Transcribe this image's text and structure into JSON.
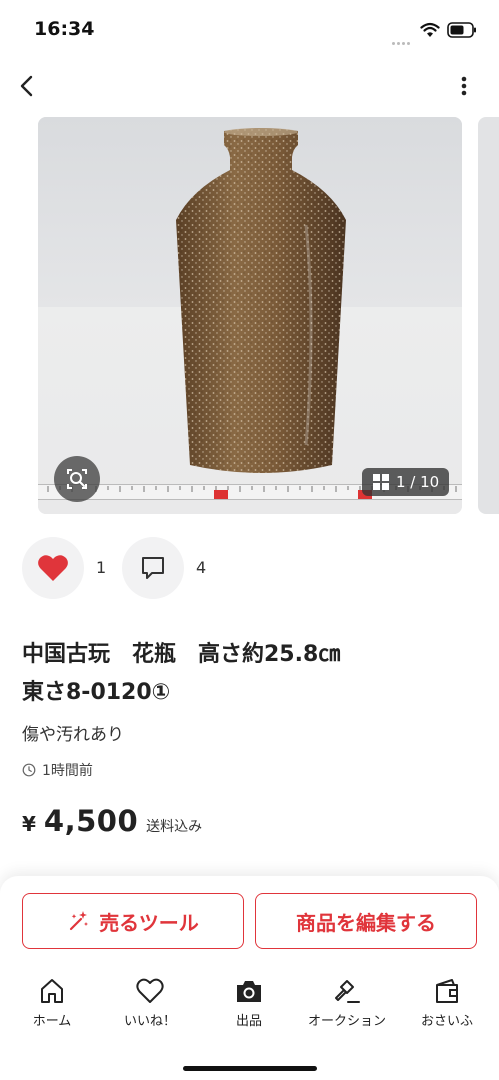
{
  "status_bar": {
    "time": "16:34"
  },
  "header": {
    "back_icon": "chevron-left-icon",
    "more_icon": "more-vertical-icon"
  },
  "gallery": {
    "counter": "1 / 10"
  },
  "engagement": {
    "like_count": "1",
    "comment_count": "4",
    "like_color": "#e0353b"
  },
  "item": {
    "title_line1": "中国古玩　花瓶　高さ約25.8㎝",
    "title_line2": "東さ8-0120①",
    "condition": "傷や汚れあり",
    "time_ago": "1時間前",
    "price_yen": "¥",
    "price_amount": "4,500",
    "shipping": "送料込み"
  },
  "actions": {
    "sell_tool": "売るツール",
    "edit_item": "商品を編集する",
    "accent": "#e0353b"
  },
  "nav": [
    {
      "label": "ホーム"
    },
    {
      "label": "いいね！"
    },
    {
      "label": "出品"
    },
    {
      "label": "オークション"
    },
    {
      "label": "おさいふ"
    }
  ]
}
